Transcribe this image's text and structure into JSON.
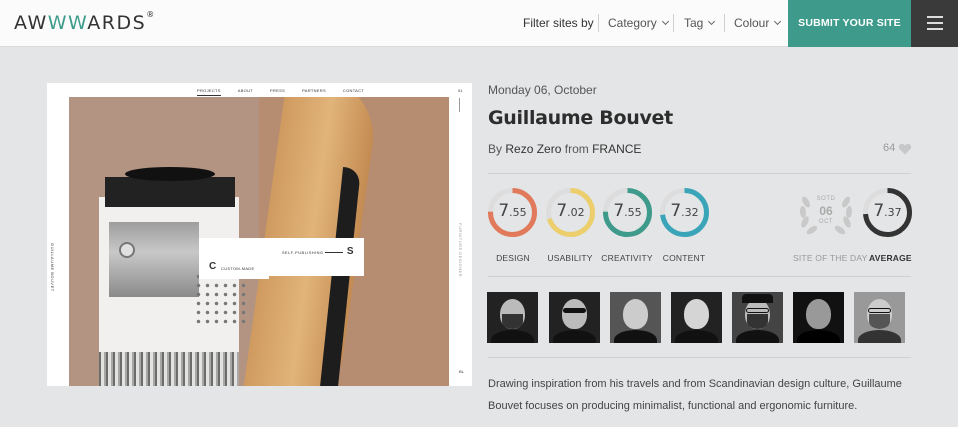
{
  "header": {
    "logo_prefix": "AW",
    "logo_ws": "WW",
    "logo_suffix": "ARDS",
    "logo_mark": "®",
    "filter_label": "Filter sites by",
    "filters": [
      "Category",
      "Tag",
      "Colour"
    ],
    "submit_label": "SUBMIT YOUR SITE"
  },
  "preview": {
    "nav": [
      "PROJECTS",
      "ABOUT",
      "PRESS",
      "PARTNERS",
      "CONTACT"
    ],
    "label_main": "SELF-PUBLISHING",
    "label_letter": "S",
    "label2_letter": "C",
    "label2_text": "CUSTOM-MADE",
    "side_left": "GUILLAUME BOUVET",
    "side_right": "FURNITURE DESIGNER",
    "counter_top": "01",
    "counter_bottom": "BL"
  },
  "site": {
    "date": "Monday 06, October",
    "title": "Guillaume Bouvet",
    "by_prefix": "By",
    "author": "Rezo Zero",
    "from_prefix": "from",
    "country": "FRANCE",
    "likes": "64"
  },
  "scores": [
    {
      "label": "DESIGN",
      "int": "7",
      "dec": ".55",
      "value": 7.55,
      "color": "#e07a5a"
    },
    {
      "label": "USABILITY",
      "int": "7",
      "dec": ".02",
      "value": 7.02,
      "color": "#eccf6c"
    },
    {
      "label": "CREATIVITY",
      "int": "7",
      "dec": ".55",
      "value": 7.55,
      "color": "#3e9b8b"
    },
    {
      "label": "CONTENT",
      "int": "7",
      "dec": ".32",
      "value": 7.32,
      "color": "#3aa4b8"
    }
  ],
  "sotd": {
    "badge_top": "SOTD",
    "badge_day": "06",
    "badge_month": "OCT",
    "label": "SITE OF THE DAY"
  },
  "average": {
    "label": "AVERAGE",
    "int": "7",
    "dec": ".37",
    "value": 7.37,
    "color": "#333333"
  },
  "jury_count": 7,
  "description": "Drawing inspiration from his travels and from Scandinavian design culture, Guillaume Bouvet focuses on producing minimalist, functional and ergonomic furniture."
}
